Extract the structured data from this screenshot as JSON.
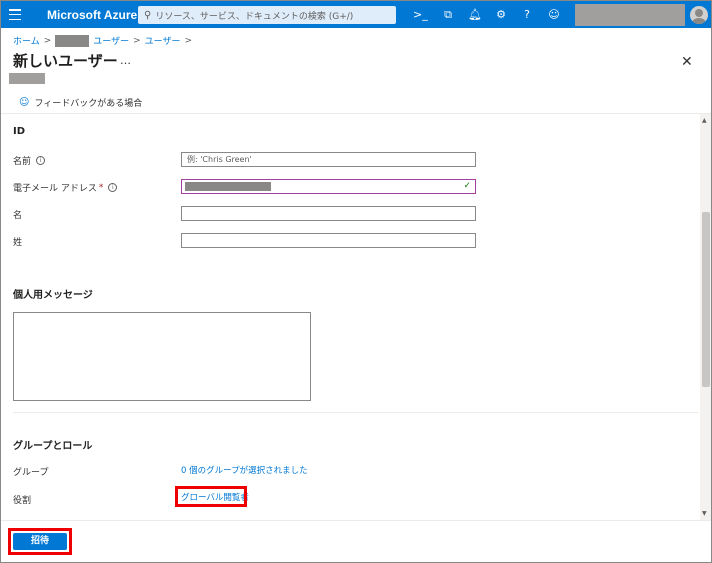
{
  "topbar": {
    "brand": "Microsoft Azure",
    "search_placeholder": "リソース、サービス、ドキュメントの検索 (G+/)",
    "icons": [
      "cloud-shell-icon",
      "directory-filter-icon",
      "notifications-icon",
      "settings-icon",
      "help-icon",
      "feedback-icon"
    ]
  },
  "breadcrumb": {
    "home": "ホーム",
    "users1": "ユーザー",
    "users2": "ユーザー"
  },
  "page": {
    "title": "新しいユーザー",
    "more": "…",
    "close": "✕"
  },
  "feedback": {
    "label": "フィードバックがある場合"
  },
  "identity": {
    "heading": "ID",
    "name_label": "名前",
    "name_placeholder": "例: 'Chris Green'",
    "email_label": "電子メール アドレス",
    "required_mark": "*",
    "first_label": "名",
    "last_label": "姓"
  },
  "message": {
    "heading": "個人用メッセージ"
  },
  "groups": {
    "heading": "グループとロール",
    "group_label": "グループ",
    "group_link": "0 個のグループが選択されました",
    "role_label": "役割",
    "role_link": "グローバル閲覧者"
  },
  "footer": {
    "invite_label": "招待"
  },
  "colors": {
    "accent": "#0078d4",
    "highlight": "#ee0000"
  }
}
